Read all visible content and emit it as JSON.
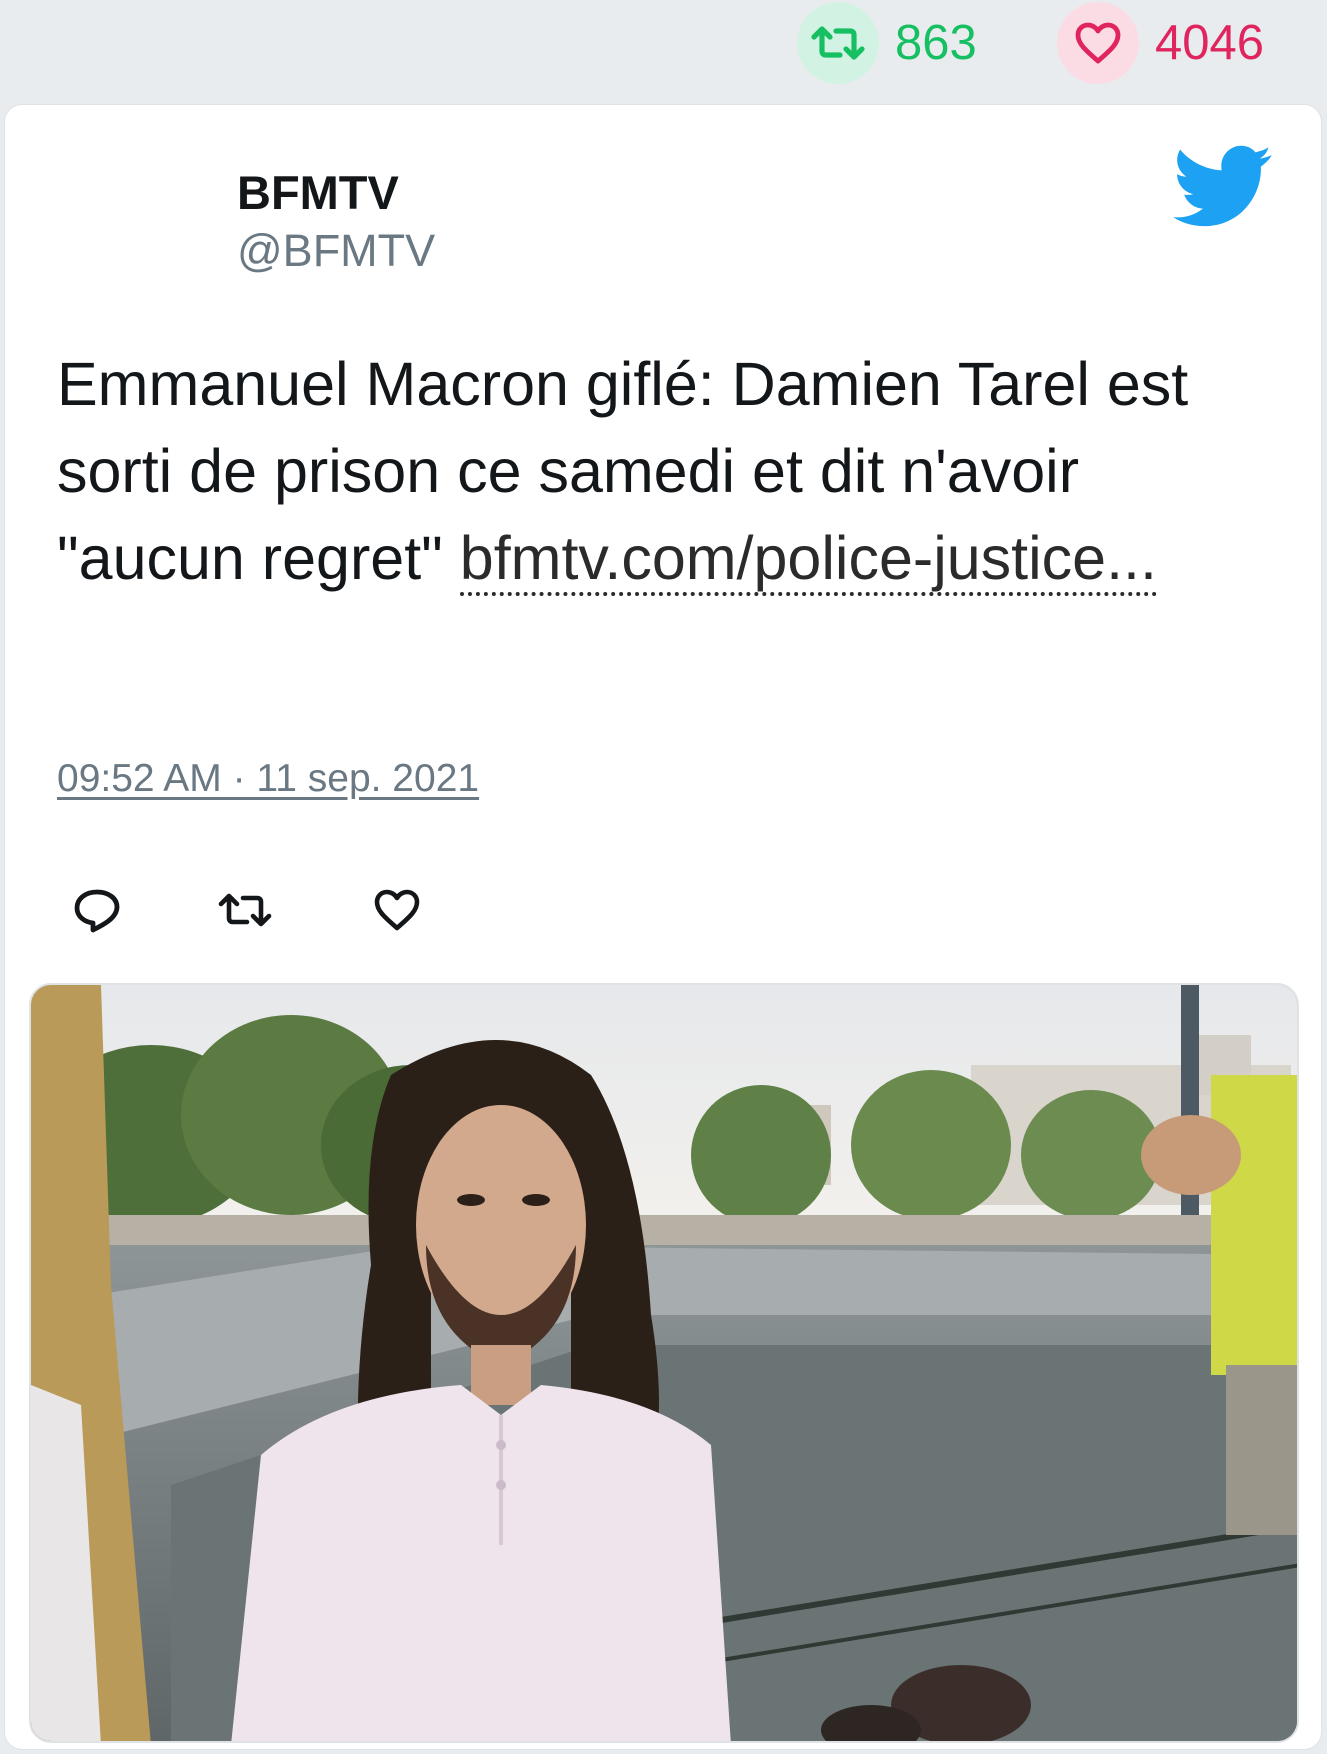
{
  "stats": {
    "retweets": "863",
    "likes": "4046"
  },
  "tweet": {
    "author_name": "BFMTV",
    "author_handle": "@BFMTV",
    "text": "Emmanuel Macron giflé: Damien Tarel est sorti de prison ce samedi et dit n'avoir \"aucun regret\" ",
    "link_text": "bfmtv.com/police-justice...",
    "timestamp": "09:52 AM · 11 sep. 2021"
  },
  "icons": {
    "retweet": "retweet-icon",
    "like": "heart-icon",
    "reply": "reply-icon",
    "brand": "twitter-bird-icon"
  },
  "colors": {
    "retweet": "#17bf63",
    "like": "#e0245e",
    "brand": "#1da1f2",
    "secondary_text": "#697882"
  }
}
